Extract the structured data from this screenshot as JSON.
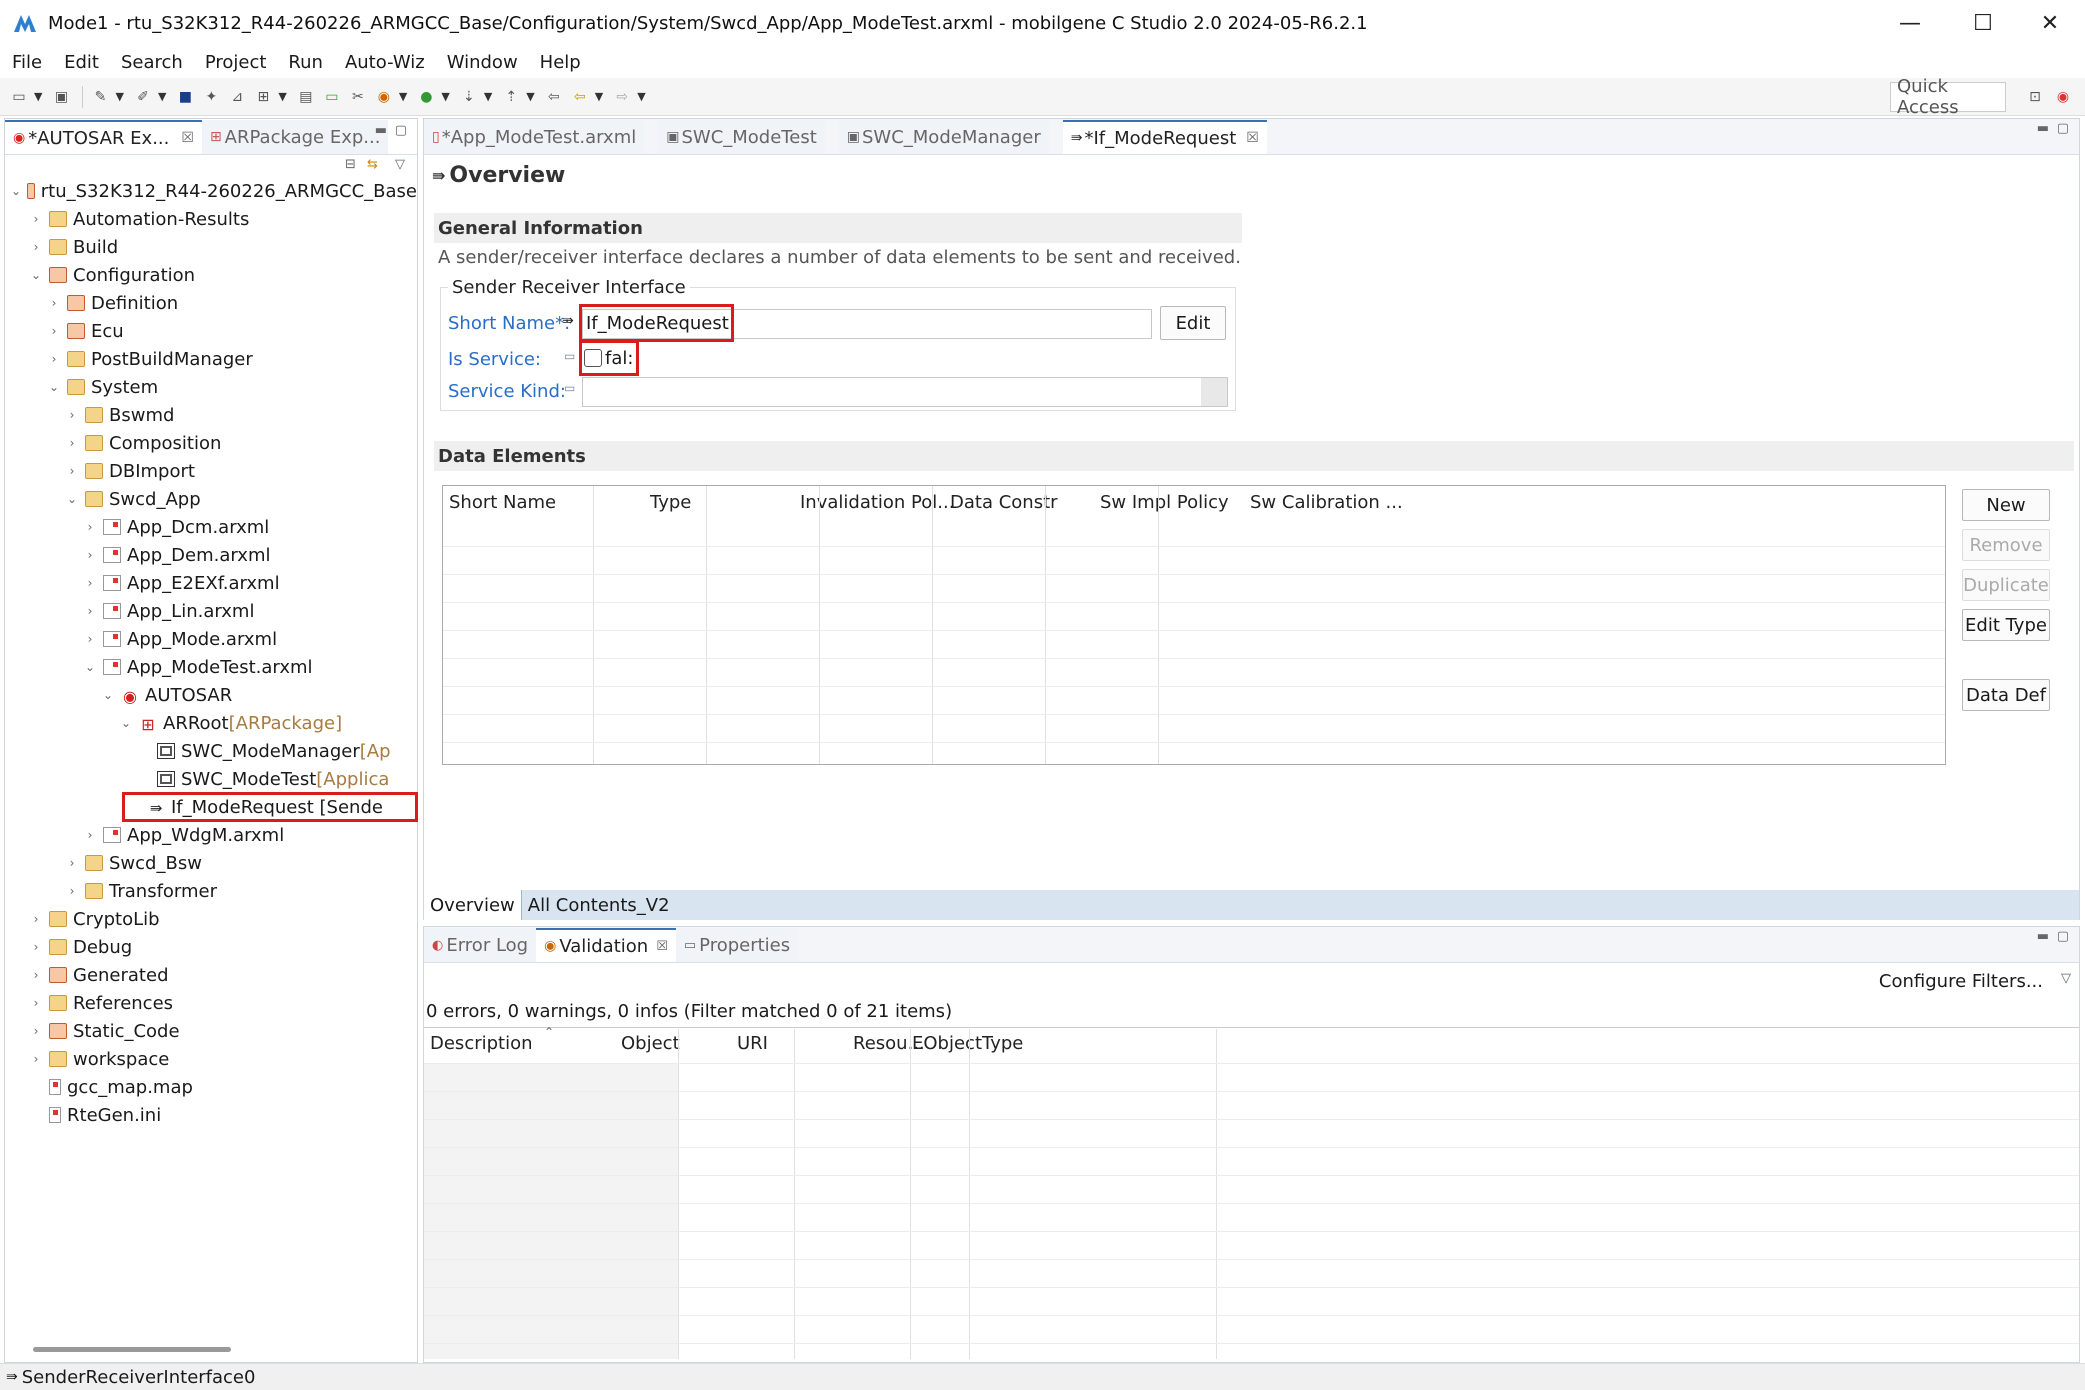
{
  "window": {
    "title": "Mode1 - rtu_S32K312_R44-260226_ARMGCC_Base/Configuration/System/Swcd_App/App_ModeTest.arxml - mobilgene C Studio 2.0 2024-05-R6.2.1",
    "minimize": "—",
    "maximize": "☐",
    "close": "✕"
  },
  "menu": [
    "File",
    "Edit",
    "Search",
    "Project",
    "Run",
    "Auto-Wiz",
    "Window",
    "Help"
  ],
  "quick_access": "Quick Access",
  "left": {
    "tabs": [
      "*AUTOSAR Ex...",
      "ARPackage Exp..."
    ],
    "tree": [
      {
        "label": "rtu_S32K312_R44-260226_ARMGCC_Base",
        "depth": 0,
        "tw": "⌄",
        "icon": "project"
      },
      {
        "label": "Automation-Results",
        "depth": 1,
        "tw": "›",
        "icon": "folder"
      },
      {
        "label": "Build",
        "depth": 1,
        "tw": "›",
        "icon": "folder"
      },
      {
        "label": "Configuration",
        "depth": 1,
        "tw": "⌄",
        "icon": "rfolder"
      },
      {
        "label": "Definition",
        "depth": 2,
        "tw": "›",
        "icon": "rfolder"
      },
      {
        "label": "Ecu",
        "depth": 2,
        "tw": "›",
        "icon": "rfolder"
      },
      {
        "label": "PostBuildManager",
        "depth": 2,
        "tw": "›",
        "icon": "folder"
      },
      {
        "label": "System",
        "depth": 2,
        "tw": "⌄",
        "icon": "folder"
      },
      {
        "label": "Bswmd",
        "depth": 3,
        "tw": "›",
        "icon": "folder"
      },
      {
        "label": "Composition",
        "depth": 3,
        "tw": "›",
        "icon": "folder"
      },
      {
        "label": "DBImport",
        "depth": 3,
        "tw": "›",
        "icon": "folder"
      },
      {
        "label": "Swcd_App",
        "depth": 3,
        "tw": "⌄",
        "icon": "folder"
      },
      {
        "label": "App_Dcm.arxml",
        "depth": 4,
        "tw": "›",
        "icon": "file"
      },
      {
        "label": "App_Dem.arxml",
        "depth": 4,
        "tw": "›",
        "icon": "file"
      },
      {
        "label": "App_E2EXf.arxml",
        "depth": 4,
        "tw": "›",
        "icon": "file"
      },
      {
        "label": "App_Lin.arxml",
        "depth": 4,
        "tw": "›",
        "icon": "file"
      },
      {
        "label": "App_Mode.arxml",
        "depth": 4,
        "tw": "›",
        "icon": "file"
      },
      {
        "label": "App_ModeTest.arxml",
        "depth": 4,
        "tw": "⌄",
        "icon": "file"
      },
      {
        "label": "AUTOSAR",
        "depth": 5,
        "tw": "⌄",
        "icon": "autosar"
      },
      {
        "label": "ARRoot",
        "suffix": " [ARPackage]",
        "depth": 6,
        "tw": "⌄",
        "icon": "pkg"
      },
      {
        "label": "SWC_ModeManager",
        "suffix": " [Ap",
        "depth": 7,
        "tw": "",
        "icon": "cmp"
      },
      {
        "label": "SWC_ModeTest",
        "suffix": " [Applica",
        "depth": 7,
        "tw": "",
        "icon": "cmp"
      },
      {
        "label": "If_ModeRequest [Sende",
        "depth": 7,
        "tw": "",
        "icon": "arr",
        "highlight": true
      },
      {
        "label": "App_WdgM.arxml",
        "depth": 4,
        "tw": "›",
        "icon": "file"
      },
      {
        "label": "Swcd_Bsw",
        "depth": 3,
        "tw": "›",
        "icon": "folder"
      },
      {
        "label": "Transformer",
        "depth": 3,
        "tw": "›",
        "icon": "folder"
      },
      {
        "label": "CryptoLib",
        "depth": 1,
        "tw": "›",
        "icon": "folder"
      },
      {
        "label": "Debug",
        "depth": 1,
        "tw": "›",
        "icon": "folder"
      },
      {
        "label": "Generated",
        "depth": 1,
        "tw": "›",
        "icon": "rfolder"
      },
      {
        "label": "References",
        "depth": 1,
        "tw": "›",
        "icon": "folder"
      },
      {
        "label": "Static_Code",
        "depth": 1,
        "tw": "›",
        "icon": "rfolder"
      },
      {
        "label": "workspace",
        "depth": 1,
        "tw": "›",
        "icon": "folder"
      },
      {
        "label": "gcc_map.map",
        "depth": 1,
        "tw": "",
        "icon": "plain"
      },
      {
        "label": "RteGen.ini",
        "depth": 1,
        "tw": "",
        "icon": "plain"
      }
    ]
  },
  "editor": {
    "tabs": [
      "*App_ModeTest.arxml",
      "SWC_ModeTest",
      "SWC_ModeManager",
      "*If_ModeRequest"
    ],
    "heading": "Overview",
    "general_title": "General Information",
    "general_desc": "A sender/receiver interface declares a number of data elements to be sent and received.",
    "group_title": "Sender Receiver Interface",
    "short_name_label": "Short Name*:",
    "short_name_value": "If_ModeRequest",
    "edit_btn": "Edit",
    "is_service_label": "Is Service:",
    "is_service_value": "fal:",
    "service_kind_label": "Service Kind:",
    "data_elements_title": "Data Elements",
    "columns": [
      "Short Name",
      "Type",
      "Invalidation Pol...",
      "Data Constr",
      "Sw Impl Policy",
      "Sw Calibration ..."
    ],
    "buttons": {
      "new": "New",
      "remove": "Remove",
      "duplicate": "Duplicate",
      "edit_type": "Edit Type",
      "data_def": "Data Def"
    },
    "bottom_tabs": [
      "Overview",
      "All Contents_V2"
    ]
  },
  "bottom": {
    "tabs": [
      "Error Log",
      "Validation",
      "Properties"
    ],
    "configure": "Configure Filters...",
    "summary": "0 errors, 0 warnings, 0 infos (Filter matched 0 of 21 items)",
    "columns": [
      "Description",
      "Object",
      "URI",
      "Resou...",
      "EObjectType"
    ]
  },
  "status": "SenderReceiverInterface0"
}
